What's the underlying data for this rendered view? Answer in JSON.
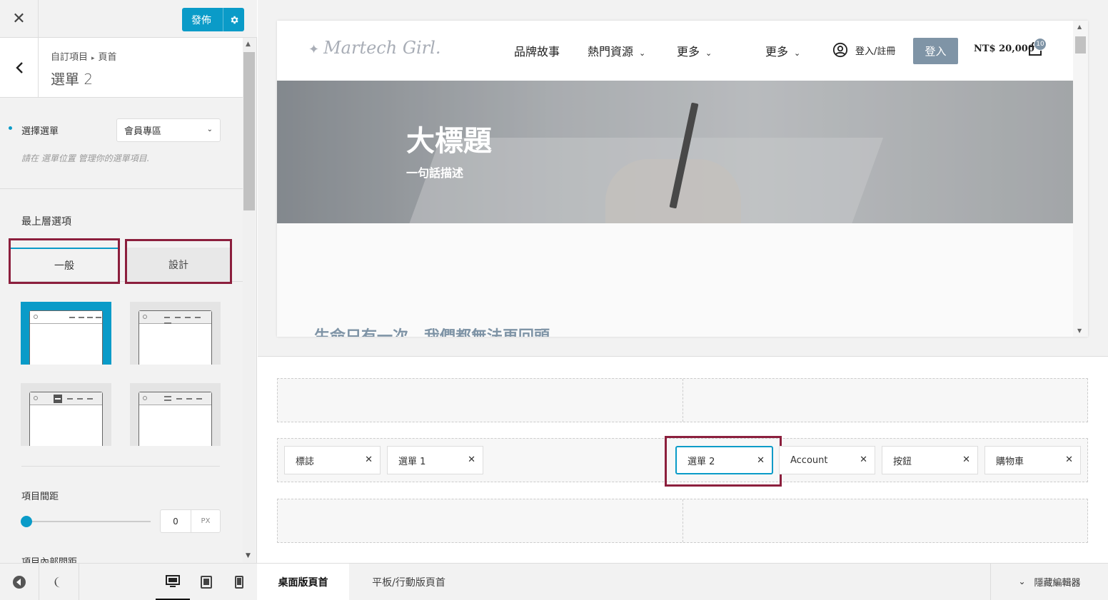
{
  "topbar": {
    "close_glyph": "✕",
    "publish_label": "發佈"
  },
  "panel": {
    "breadcrumb": [
      "自訂項目",
      "頁首"
    ],
    "breadcrumb_sep": "▸",
    "title": "選單 2"
  },
  "menu_select": {
    "label": "選擇選單",
    "value": "會員專區",
    "hint": "請在 選單位置 管理你的選單項目."
  },
  "top_options": {
    "label": "最上層選項",
    "tabs": [
      "一般",
      "設計"
    ],
    "active_tab": "一般"
  },
  "layout_options": {
    "count": 4,
    "selected_index": 0
  },
  "spacing": {
    "label": "項目間距",
    "value": "0",
    "unit": "PX",
    "slider_fraction": 0
  },
  "inner_spacing": {
    "label": "項目內部間距"
  },
  "devices": {
    "active": "desktop",
    "icons": [
      "desktop-icon",
      "tablet-icon",
      "mobile-icon"
    ]
  },
  "site": {
    "logo": "Martech Girl.",
    "nav": [
      {
        "label": "品牌故事",
        "dropdown": false
      },
      {
        "label": "熱門資源",
        "dropdown": true
      },
      {
        "label": "更多",
        "dropdown": true
      },
      {
        "label": "更多",
        "dropdown": true
      }
    ],
    "login_link": "登入/註冊",
    "login_button": "登入",
    "price": "NT$ 20,000",
    "cart_count": "10",
    "hero_title": "大標題",
    "hero_subtitle": "一句話描述",
    "quote": "生命只有一次，我們都無法再回頭"
  },
  "builder": {
    "left_items": [
      "標誌",
      "選單 1"
    ],
    "right_items": [
      "選單 2",
      "Account",
      "按鈕",
      "購物車"
    ],
    "active_item": "選單 2"
  },
  "bottom_tabs": [
    "桌面版頁首",
    "平板/行動版頁首"
  ],
  "hide_editor": "隱藏編輯器",
  "colors": {
    "accent": "#0a9bc8",
    "highlight": "#8c1f3d",
    "brand_button": "#7f94a6"
  }
}
